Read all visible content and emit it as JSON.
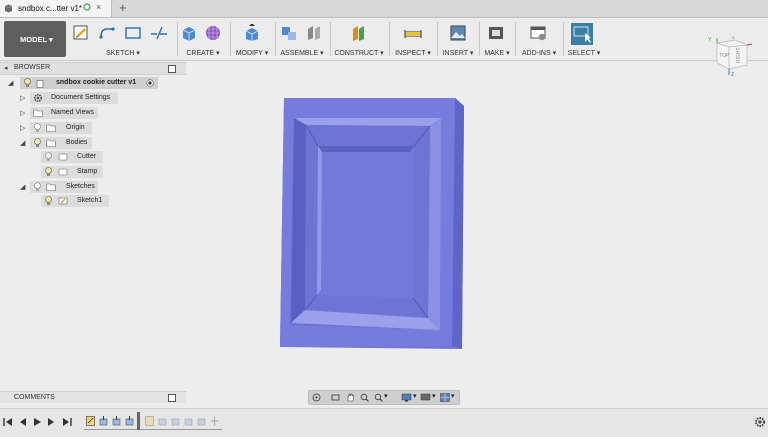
{
  "tab": {
    "title": "sndbox c...tter v1*",
    "close": "×",
    "new": "+"
  },
  "toolbar": {
    "workspace": "MODEL ▾",
    "groups": [
      "SKETCH ▾",
      "CREATE ▾",
      "MODIFY ▾",
      "ASSEMBLE ▾",
      "CONSTRUCT ▾",
      "INSPECT ▾",
      "INSERT ▾",
      "MAKE ▾",
      "ADD-INS ▾",
      "SELECT ▾"
    ]
  },
  "viewcube": {
    "top": "TOP",
    "right": "RIGHT",
    "axis_x": "X",
    "axis_y": "Y",
    "axis_z": "Z"
  },
  "browser": {
    "title": "BROWSER",
    "root": "sndbox cookie cutter v1",
    "items": [
      "Document Settings",
      "Named Views",
      "Origin",
      "Bodies",
      "Cutter",
      "Stamp",
      "Sketches",
      "Sketch1"
    ]
  },
  "comments": {
    "title": "COMMENTS"
  },
  "colors": {
    "accent": "#3a7ab8",
    "model": "#6f76d6",
    "model_dark": "#5a61bf",
    "select": "#3c7fa6"
  },
  "icons": [
    "sketch-icon",
    "line-icon",
    "arc-icon",
    "rectangle-icon",
    "box-icon",
    "form-icon",
    "press-pull-icon",
    "joint-icon",
    "plane-icon",
    "measure-icon",
    "insert-image-icon",
    "print-icon",
    "scripts-icon",
    "select-icon",
    "gear-icon"
  ]
}
